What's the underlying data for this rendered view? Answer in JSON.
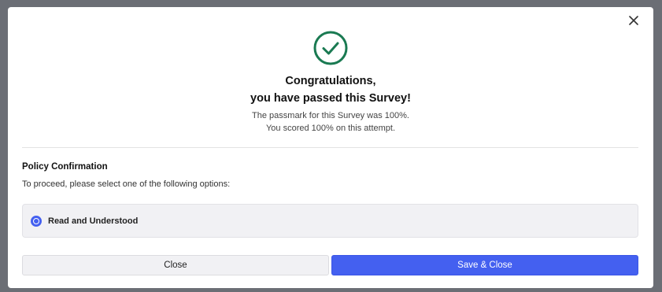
{
  "dialog": {
    "close_icon": "close-icon",
    "success_icon": "check-circle-icon",
    "success_color": "#1a7a52",
    "title_line1": "Congratulations,",
    "title_line2": "you have passed this Survey!",
    "passmark_text": "The passmark for this Survey was 100%.",
    "score_text": "You scored 100% on this attempt."
  },
  "policy": {
    "heading": "Policy Confirmation",
    "instruction": "To proceed, please select one of the following options:",
    "options": [
      {
        "label": "Read and Understood",
        "selected": true
      }
    ]
  },
  "buttons": {
    "close_label": "Close",
    "save_close_label": "Save & Close"
  },
  "colors": {
    "accent": "#4460f0",
    "overlay": "#6b6e75"
  }
}
